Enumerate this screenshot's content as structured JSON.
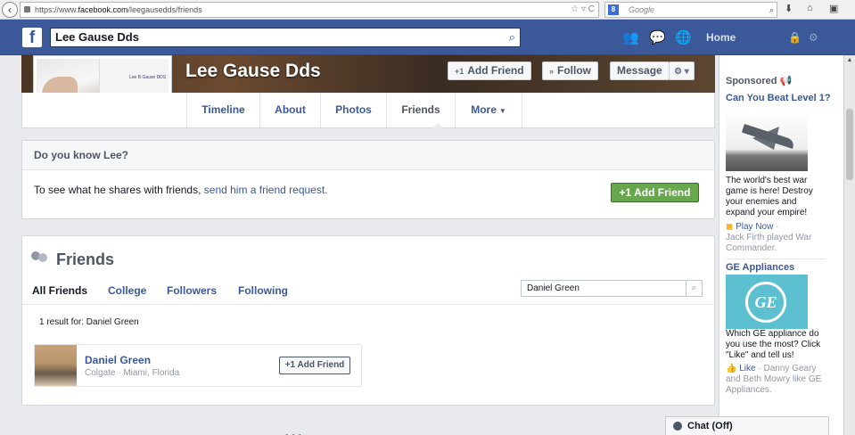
{
  "browser": {
    "url_prefix": "https://www.",
    "url_domain": "facebook.com",
    "url_path": "/leegausedds/friends",
    "search_placeholder": "Google",
    "search_engine_badge": "8"
  },
  "topbar": {
    "logo": "f",
    "search_value": "Lee Gause Dds",
    "home": "Home"
  },
  "profile": {
    "name": "Lee Gause Dds",
    "coat_text": "Lee B Gause DDS",
    "buttons": {
      "add_friend": "Add Friend",
      "follow": "Follow",
      "message": "Message"
    },
    "tabs": [
      "Timeline",
      "About",
      "Photos",
      "Friends",
      "More"
    ]
  },
  "know": {
    "heading": "Do you know Lee?",
    "body_text": "To see what he shares with friends, ",
    "body_link": "send him a friend request.",
    "button": "Add Friend"
  },
  "friends": {
    "heading": "Friends",
    "subtabs": [
      "All Friends",
      "College",
      "Followers",
      "Following"
    ],
    "search_value": "Daniel Green",
    "result_text": "1 result for: Daniel Green",
    "card": {
      "name": "Daniel Green",
      "info": "Colgate · Miami, Florida",
      "button": "Add Friend"
    }
  },
  "sidebar": {
    "sponsored": "Sponsored",
    "ad1": {
      "title": "Can You Beat Level 1?",
      "text": "The world's best war game is here! Destroy your enemies and expand your empire!",
      "play": "Play Now",
      "social": "Jack Firth played War Commander."
    },
    "ad2": {
      "title": "GE Appliances",
      "logo": "GE",
      "text": "Which GE appliance do you use the most? Click \"Like\" and tell us!",
      "like": "Like",
      "social": "Danny Geary and Beth Mowry like GE Appliances."
    }
  },
  "chat": {
    "label": "Chat (Off)"
  },
  "colors": {
    "fb_blue": "#3b5998",
    "green_button": "#69a74e"
  }
}
